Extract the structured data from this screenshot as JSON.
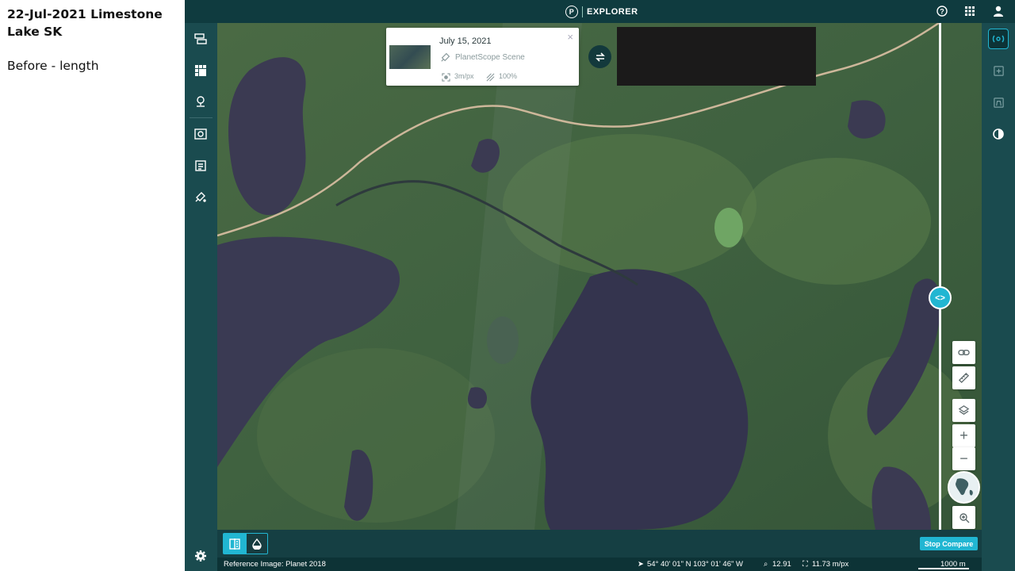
{
  "notes": {
    "title": "22-Jul-2021 Limestone Lake SK",
    "subtitle": "Before - length"
  },
  "topbar": {
    "logo_letter": "P",
    "app_name": "EXPLORER",
    "icons": [
      "help-icon",
      "apps-grid-icon",
      "user-icon"
    ]
  },
  "left_rail": {
    "icons": [
      "layers-stack-icon",
      "mosaic-grid-icon",
      "place-pin-icon",
      "map-scene-icon",
      "feed-icon",
      "satellite-icon",
      "settings-icon"
    ]
  },
  "right_rail": {
    "icons": [
      "radar-icon",
      "export-icon",
      "analytics-icon",
      "contrast-icon"
    ],
    "active": "radar-icon"
  },
  "scene_card": {
    "date": "July 15, 2021",
    "type": "PlanetScope Scene",
    "resolution": "3m/px",
    "coverage": "100%",
    "close_label": "×"
  },
  "compare": {
    "handle_label": "<>",
    "stop_label": "Stop Compare"
  },
  "map_tools": {
    "icons": [
      "link-icon",
      "ruler-icon",
      "layers-icon",
      "zoom-in-icon",
      "zoom-out-icon",
      "globe-icon",
      "zoom-search-icon"
    ],
    "zoom_in_label": "+",
    "zoom_out_label": "−"
  },
  "status": {
    "reference": "Reference Image: Planet 2018",
    "coordinates": "54° 40' 01\" N 103° 01' 46\" W",
    "zoom": "12.91",
    "resolution": "11.73 m/px",
    "scale": "1000 m"
  },
  "colors": {
    "topbar": "#0f3b3f",
    "rail": "#1a4b4f",
    "accent": "#21b6d2"
  }
}
